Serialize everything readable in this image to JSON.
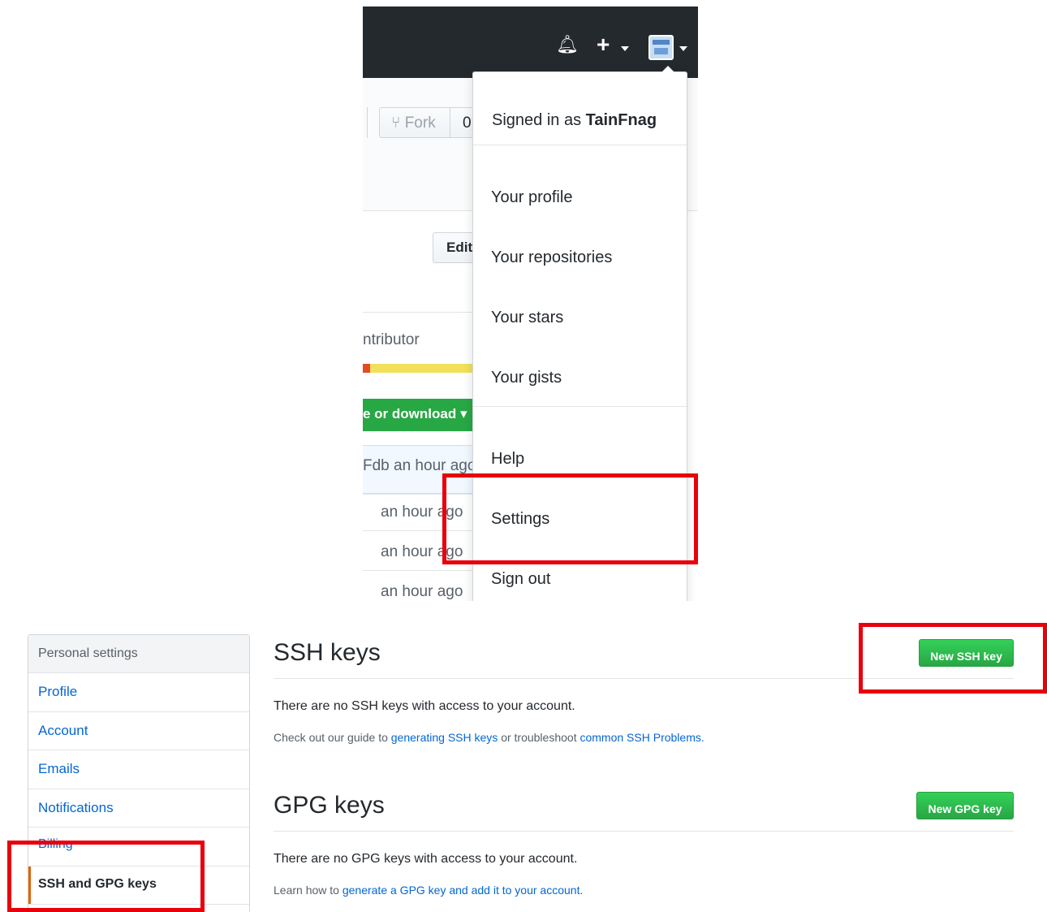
{
  "top": {
    "fork": {
      "label": "Fork",
      "count": "0"
    },
    "edit_label": "Edit",
    "contributor_text": "ntributor",
    "clone_label": "e or download",
    "commits": [
      {
        "text": "Fdb an hour ago"
      },
      {
        "text": "an hour ago"
      },
      {
        "text": "an hour ago"
      },
      {
        "text": "an hour ago"
      }
    ],
    "dropdown": {
      "signed_in_prefix": "Signed in as",
      "username": "TainFnag",
      "items": {
        "profile": "Your profile",
        "repositories": "Your repositories",
        "stars": "Your stars",
        "gists": "Your gists",
        "help": "Help",
        "settings": "Settings",
        "signout": "Sign out"
      }
    }
  },
  "settings": {
    "sidebar": {
      "heading": "Personal settings",
      "items": [
        "Profile",
        "Account",
        "Emails",
        "Notifications",
        "Billing",
        "SSH and GPG keys"
      ]
    },
    "ssh": {
      "title": "SSH keys",
      "button": "New SSH key",
      "empty": "There are no SSH keys with access to your account.",
      "help_prefix": "Check out our guide to",
      "help_link1": "generating SSH keys",
      "help_middle": "or troubleshoot",
      "help_link2": "common SSH Problems."
    },
    "gpg": {
      "title": "GPG keys",
      "button": "New GPG key",
      "empty": "There are no GPG keys with access to your account.",
      "help_prefix": "Learn how to",
      "help_link": "generate a GPG key and add it to your account."
    }
  },
  "colors": {
    "header_bg": "#24292e",
    "green_button": "#28a745",
    "link": "#0366d6",
    "highlight_red": "#e8000b",
    "selected_accent": "#e36209"
  }
}
